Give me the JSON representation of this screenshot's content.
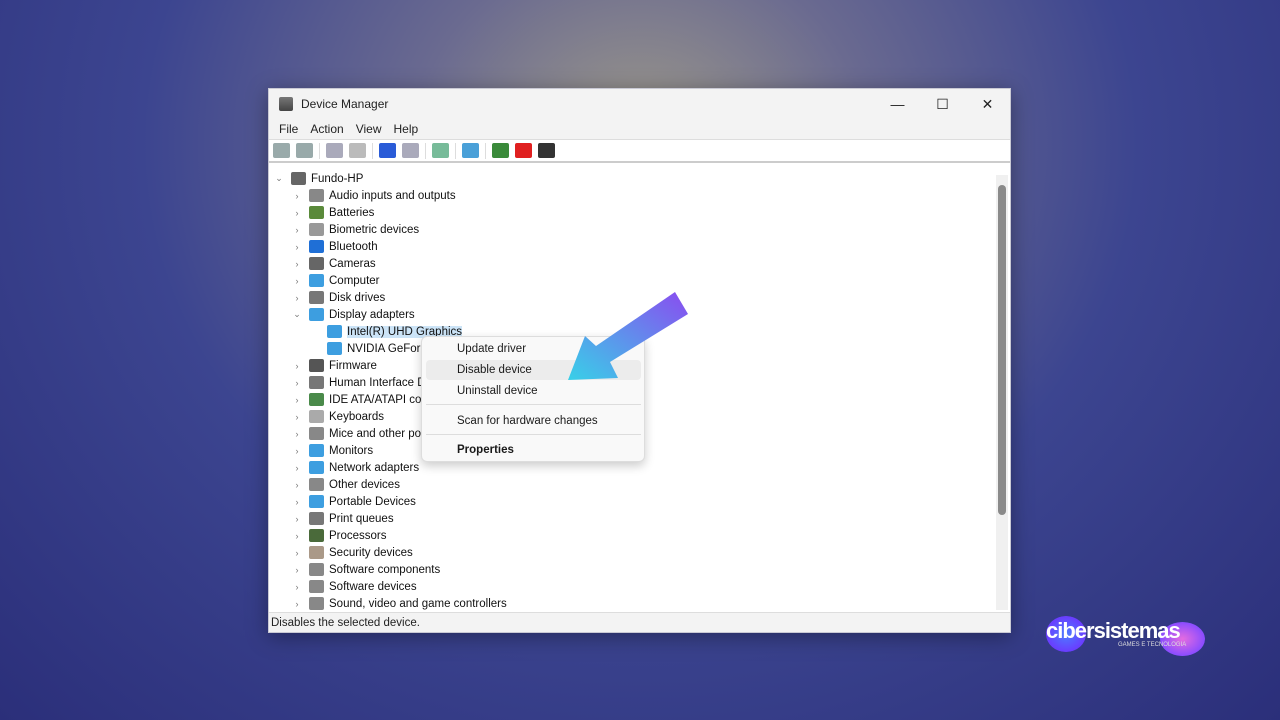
{
  "window": {
    "title": "Device Manager",
    "minimize": "—",
    "maximize": "☐",
    "close": "✕"
  },
  "menubar": [
    "File",
    "Action",
    "View",
    "Help"
  ],
  "toolbar": [
    {
      "icon": "back-icon",
      "color": "#9aa"
    },
    {
      "icon": "forward-icon",
      "color": "#9aa"
    },
    {
      "icon": "properties-icon",
      "color": "#aab"
    },
    {
      "icon": "list-icon",
      "color": "#bbb"
    },
    {
      "icon": "help-icon",
      "color": "#2a5bd7"
    },
    {
      "icon": "view-icon",
      "color": "#aab"
    },
    {
      "icon": "scan-icon",
      "color": "#7b9"
    },
    {
      "icon": "monitor-icon",
      "color": "#4aa0d8"
    },
    {
      "icon": "enable-device-icon",
      "color": "#3a8a3a"
    },
    {
      "icon": "uninstall-icon",
      "color": "#e02020"
    },
    {
      "icon": "update-driver-icon",
      "color": "#333"
    }
  ],
  "tree": {
    "root": "Fundo-HP",
    "items": [
      {
        "label": "Audio inputs and outputs",
        "color": "#888"
      },
      {
        "label": "Batteries",
        "color": "#5a8a3a"
      },
      {
        "label": "Biometric devices",
        "color": "#999"
      },
      {
        "label": "Bluetooth",
        "color": "#1f6fd6"
      },
      {
        "label": "Cameras",
        "color": "#666"
      },
      {
        "label": "Computer",
        "color": "#3d9ee0"
      },
      {
        "label": "Disk drives",
        "color": "#777"
      },
      {
        "label": "Display adapters",
        "color": "#3d9ee0",
        "expanded": true,
        "children": [
          "Intel(R) UHD Graphics",
          "NVIDIA GeForce"
        ]
      },
      {
        "label": "Firmware",
        "color": "#555"
      },
      {
        "label": "Human Interface Devices",
        "color": "#777"
      },
      {
        "label": "IDE ATA/ATAPI controllers",
        "color": "#4a8a4a"
      },
      {
        "label": "Keyboards",
        "color": "#aaa"
      },
      {
        "label": "Mice and other pointing devices",
        "color": "#888"
      },
      {
        "label": "Monitors",
        "color": "#3d9ee0"
      },
      {
        "label": "Network adapters",
        "color": "#3d9ee0"
      },
      {
        "label": "Other devices",
        "color": "#888"
      },
      {
        "label": "Portable Devices",
        "color": "#3d9ee0"
      },
      {
        "label": "Print queues",
        "color": "#777"
      },
      {
        "label": "Processors",
        "color": "#4a6a3a"
      },
      {
        "label": "Security devices",
        "color": "#a98"
      },
      {
        "label": "Software components",
        "color": "#888"
      },
      {
        "label": "Software devices",
        "color": "#888"
      },
      {
        "label": "Sound, video and game controllers",
        "color": "#888"
      }
    ]
  },
  "context_menu": {
    "items": [
      "Update driver",
      "Disable device",
      "Uninstall device",
      "Scan for hardware changes",
      "Properties"
    ],
    "highlighted": "Disable device"
  },
  "status": "Disables the selected device.",
  "logo": {
    "name": "cibersistemas",
    "tagline": "GAMES E TECNOLOGIA"
  }
}
